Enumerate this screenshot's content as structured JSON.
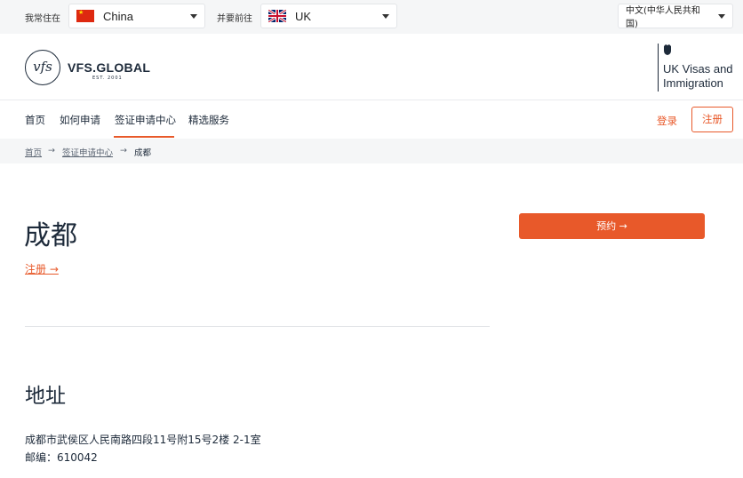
{
  "topbar": {
    "residence_label": "我常住在",
    "residence_country": "China",
    "destination_label": "并要前往",
    "destination_country": "UK",
    "language": "中文(中华人民共和国)"
  },
  "header": {
    "logo_mark": "vfs",
    "logo_text": "VFS.GLOBAL",
    "logo_sub": "EST. 2001",
    "partner_text": "UK Visas and Immigration"
  },
  "nav": {
    "items": [
      "首页",
      "如何申请",
      "签证申请中心",
      "精选服务"
    ],
    "login": "登录",
    "register": "注册"
  },
  "breadcrumb": {
    "home": "首页",
    "centres": "签证申请中心",
    "current": "成都"
  },
  "main": {
    "title": "成都",
    "register_link": "注册 →",
    "book_button": "预约 →",
    "address_title": "地址",
    "address": "成都市武侯区人民南路四段11号附15号2楼 2-1室 邮编：610042"
  },
  "colors": {
    "accent": "#e8592a",
    "text": "#1d2a3a",
    "bar_bg": "#f5f6f7"
  },
  "icons": [
    "china-flag-icon",
    "uk-flag-icon",
    "chevron-down-icon",
    "arrow-right-icon",
    "crest-icon"
  ]
}
